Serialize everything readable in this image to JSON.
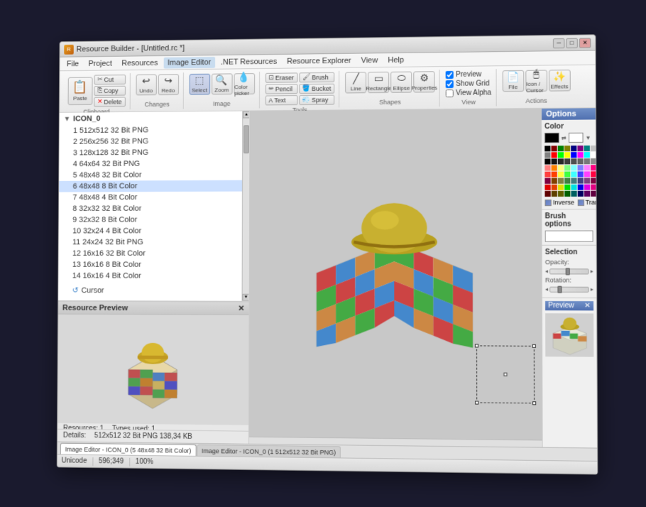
{
  "window": {
    "title": "Resource Builder - [Untitled.rc *]",
    "icon": "RB"
  },
  "titlebar": {
    "controls": [
      "minimize",
      "maximize",
      "close"
    ]
  },
  "menubar": {
    "items": [
      "File",
      "Project",
      "Resources",
      "Image Editor",
      ".NET Resources",
      "Resource Explorer",
      "View",
      "Help"
    ]
  },
  "toolbar": {
    "clipboard_label": "Clipboard",
    "changes_label": "Changes",
    "image_label": "Image",
    "tools_label": "Tools",
    "shapes_label": "Shapes",
    "view_label": "View",
    "actions_label": "Actions",
    "paste_label": "Paste",
    "cut_label": "Cut",
    "copy_label": "Copy",
    "delete_label": "Delete",
    "undo_label": "Undo",
    "redo_label": "Redo",
    "select_label": "Select",
    "zoom_label": "Zoom",
    "color_picker_label": "Color picker",
    "eraser_label": "Eraser",
    "pencil_label": "Pencil",
    "text_label": "Text",
    "brush_label": "Brush",
    "bucket_label": "Bucket",
    "spray_label": "Spray",
    "line_label": "Line",
    "rectangle_label": "Rectangle",
    "ellipse_label": "Ellipse",
    "properties_label": "Properties",
    "preview_label": "Preview",
    "show_grid_label": "Show Grid",
    "view_alpha_label": "View Alpha",
    "file_label": "File",
    "icon_cursor_label": "Icon / Cursor",
    "effects_label": "Effects"
  },
  "resource_tree": {
    "root": "ICON_0",
    "items": [
      {
        "id": 1,
        "label": "1 512x512 32 Bit PNG",
        "selected": false
      },
      {
        "id": 2,
        "label": "2 256x256 32 Bit PNG",
        "selected": false
      },
      {
        "id": 3,
        "label": "3 128x128 32 Bit PNG",
        "selected": false
      },
      {
        "id": 4,
        "label": "4 64x64 32 Bit PNG",
        "selected": false
      },
      {
        "id": 5,
        "label": "5 48x48 32 Bit Color",
        "selected": false
      },
      {
        "id": 6,
        "label": "6 48x48 8 Bit Color",
        "selected": true
      },
      {
        "id": 7,
        "label": "7 48x48 4 Bit Color",
        "selected": false
      },
      {
        "id": 8,
        "label": "8 32x32 32 Bit Color",
        "selected": false
      },
      {
        "id": 9,
        "label": "9 32x32 8 Bit Color",
        "selected": false
      },
      {
        "id": 10,
        "label": "10 32x24 4 Bit Color",
        "selected": false
      },
      {
        "id": 11,
        "label": "11 24x24 32 Bit PNG",
        "selected": false
      },
      {
        "id": 12,
        "label": "12 16x16 32 Bit Color",
        "selected": false
      },
      {
        "id": 13,
        "label": "13 16x16 8 Bit Color",
        "selected": false
      },
      {
        "id": 14,
        "label": "14 16x16 4 Bit Color",
        "selected": false
      }
    ],
    "cursor_label": "Cursor"
  },
  "preview_panel": {
    "title": "Resource Preview",
    "details_label": "Details:",
    "details_value": "512x512 32 Bit PNG 138,34 KB",
    "resources_label": "Resources: 1",
    "types_label": "Types used: 1"
  },
  "options_panel": {
    "title": "Options",
    "color_label": "Color",
    "brush_options_label": "Brush options",
    "selection_label": "Selection",
    "opacity_label": "Opacity:",
    "rotation_label": "Rotation:",
    "preview_label": "Preview",
    "inverse_label": "Inverse",
    "transparent_label": "Transparent"
  },
  "palette_colors": [
    "#000000",
    "#800000",
    "#008000",
    "#808000",
    "#000080",
    "#800080",
    "#008080",
    "#c0c0c0",
    "#808080",
    "#ff0000",
    "#00ff00",
    "#ffff00",
    "#0000ff",
    "#ff00ff",
    "#00ffff",
    "#ffffff",
    "#000000",
    "#141414",
    "#282828",
    "#3c3c3c",
    "#505050",
    "#646464",
    "#787878",
    "#8c8c8c",
    "#ff8080",
    "#ff8000",
    "#ffff80",
    "#80ff80",
    "#80ffff",
    "#8080ff",
    "#ff80ff",
    "#ff0080",
    "#ff4040",
    "#ff4000",
    "#ffff40",
    "#40ff40",
    "#40ffff",
    "#4040ff",
    "#ff40ff",
    "#ff0040",
    "#800040",
    "#804000",
    "#808040",
    "#408040",
    "#408080",
    "#404080",
    "#804080",
    "#800040",
    "#e00000",
    "#e04000",
    "#e0e000",
    "#00e000",
    "#00e0e0",
    "#0000e0",
    "#e000e0",
    "#e00080",
    "#600000",
    "#604000",
    "#606000",
    "#006000",
    "#006060",
    "#000060",
    "#600060",
    "#600040"
  ],
  "status_bar": {
    "unicode_label": "Unicode",
    "coordinates": "596;349",
    "zoom": "100%",
    "tab1": "Image Editor - ICON_0 (5 48x48 32 Bit Color)",
    "tab2": "Image Editor - ICON_0 (1 512x512 32 Bit PNG)"
  }
}
